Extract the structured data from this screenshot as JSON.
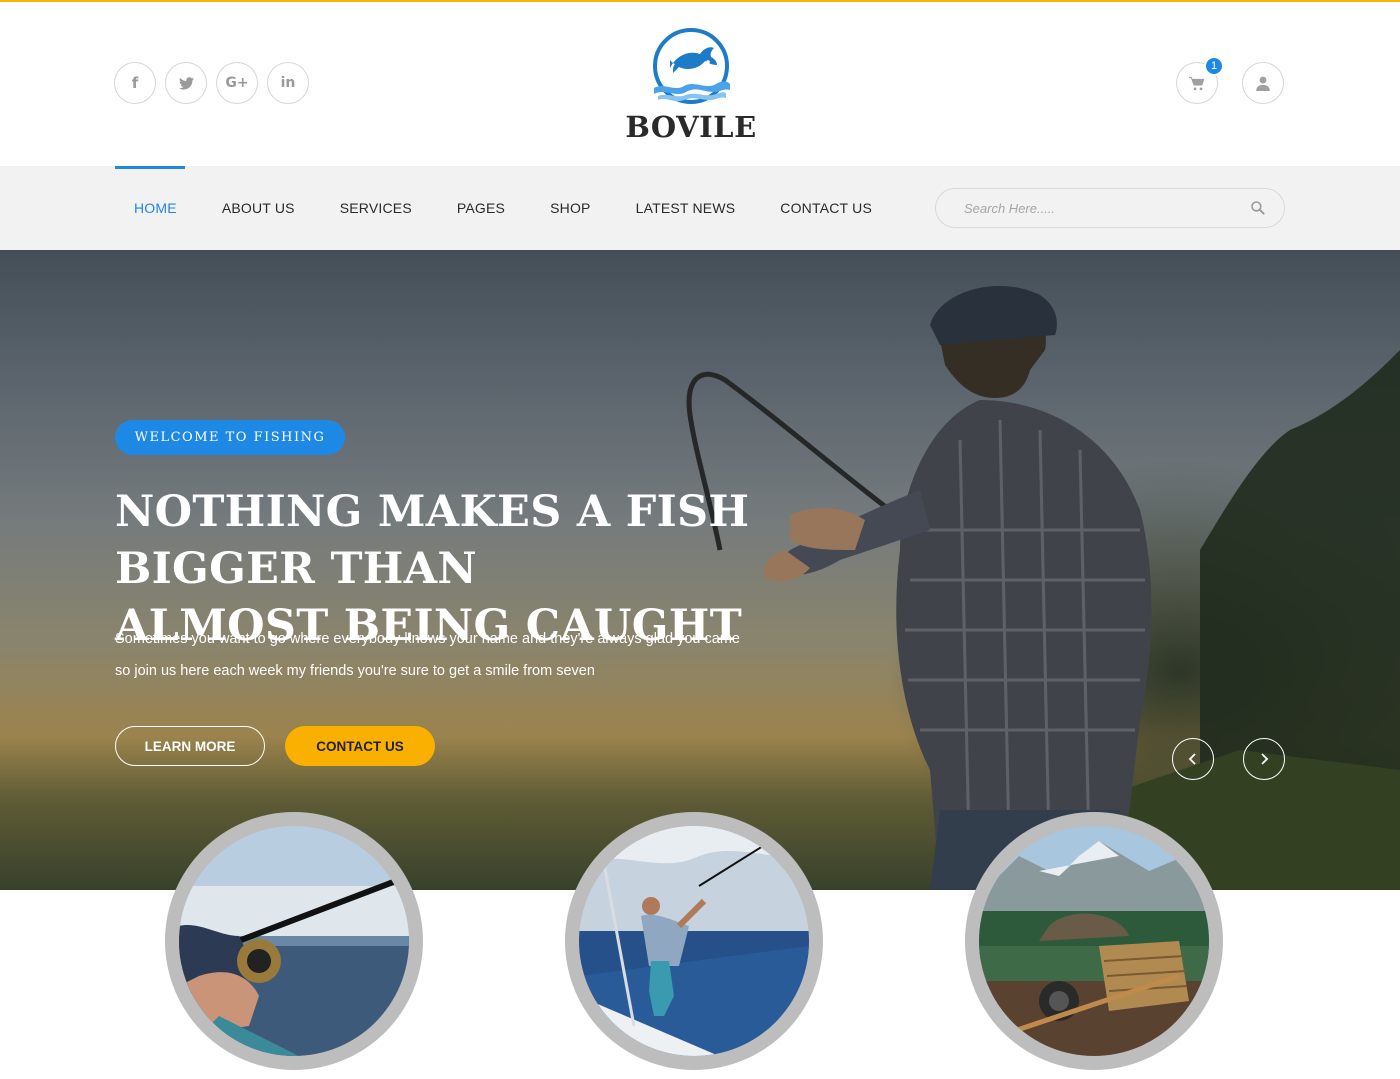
{
  "brand": {
    "name": "BOVILE",
    "accent": "#1e88e5",
    "highlight": "#f9b000"
  },
  "header": {
    "social": [
      {
        "icon": "facebook-icon"
      },
      {
        "icon": "twitter-icon"
      },
      {
        "icon": "google-plus-icon"
      },
      {
        "icon": "linkedin-icon"
      }
    ],
    "cart_count": "1"
  },
  "nav": {
    "items": [
      {
        "label": "HOME",
        "active": true
      },
      {
        "label": "ABOUT US"
      },
      {
        "label": "SERVICES"
      },
      {
        "label": "PAGES"
      },
      {
        "label": "SHOP"
      },
      {
        "label": "LATEST NEWS"
      },
      {
        "label": "CONTACT US"
      }
    ],
    "search_placeholder": "Search Here....."
  },
  "hero": {
    "tag": "WELCOME TO FISHING",
    "title_line1": "NOTHING MAKES A FISH BIGGER THAN",
    "title_line2": "ALMOST BEING CAUGHT",
    "desc_line1": "Sometimes you want to go where everybody knows your name and they're always glad you came",
    "desc_line2": "so join us here each week my friends you're sure to get a smile from seven",
    "learn_more": "LEARN MORE",
    "contact_us": "CONTACT US"
  },
  "features": [
    {
      "image": "fishing-rod-at-sea"
    },
    {
      "image": "man-fishing-on-boat"
    },
    {
      "image": "fishing-gear-by-lake"
    }
  ]
}
